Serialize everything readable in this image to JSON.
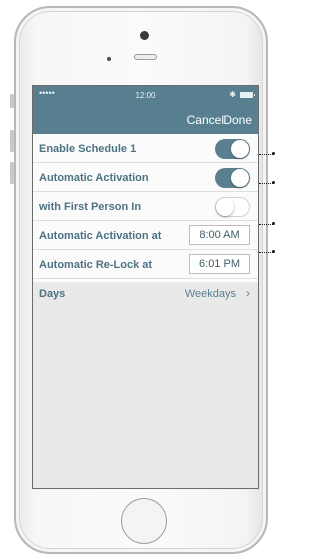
{
  "statusbar": {
    "signal": "•••••",
    "time": "12:00",
    "bluetooth": "✱"
  },
  "navbar": {
    "cancel": "Cancel",
    "done": "Done"
  },
  "rows": [
    {
      "label": "Enable Schedule 1",
      "control": "toggle",
      "on": true
    },
    {
      "label": "Automatic Activation",
      "control": "toggle",
      "on": true
    },
    {
      "label": "with First Person In",
      "control": "toggle",
      "on": false
    },
    {
      "label": "Automatic Activation at",
      "control": "time",
      "value": "8:00 AM"
    },
    {
      "label": "Automatic Re-Lock at",
      "control": "time",
      "value": "6:01 PM"
    },
    {
      "label": "Days",
      "control": "disclosure",
      "value": "Weekdays",
      "chevron": "›"
    }
  ],
  "colors": {
    "accent": "#577f8f",
    "label": "#4d7282",
    "toggle_on": "#5a8090"
  }
}
